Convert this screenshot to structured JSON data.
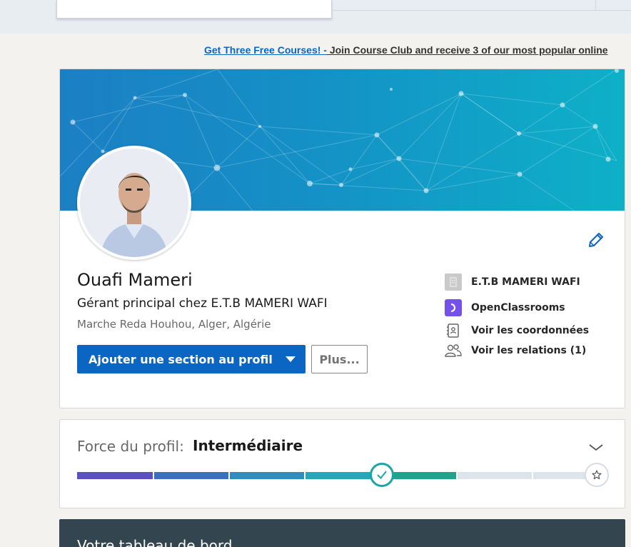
{
  "promo": {
    "link": "Get Three Free Courses! -",
    "text": " Join Course Club and receive 3 of our most popular online"
  },
  "profile": {
    "name": "Ouafi Mameri",
    "headline": "Gérant principal chez E.T.B MAMERI WAFI",
    "location": "Marche Reda Houhou, Alger, Algérie",
    "primary_button": "Ajouter une section au profil",
    "more_button": "Plus..."
  },
  "side": {
    "company": "E.T.B MAMERI WAFI",
    "school": "OpenClassrooms",
    "contact": "Voir les coordonnées",
    "connections": "Voir les relations (1)"
  },
  "strength": {
    "label": "Force du profil:",
    "value": "Intermédiaire",
    "level_fraction": 0.71
  },
  "dashboard": {
    "title": "Votre tableau de bord"
  },
  "colors": {
    "brand_blue": "#0a66c2",
    "meter_segments": [
      "#5a4fc4",
      "#3b6fbf",
      "#2d8fbf",
      "#25a9b8",
      "#1ea38c",
      "#dde4ec",
      "#dde4ec"
    ]
  },
  "icons": {
    "edit": "pencil-icon",
    "contact": "contact-card-icon",
    "connections": "people-icon",
    "expand": "chevron-down-icon",
    "achieved": "check-icon",
    "goal": "star-icon"
  }
}
